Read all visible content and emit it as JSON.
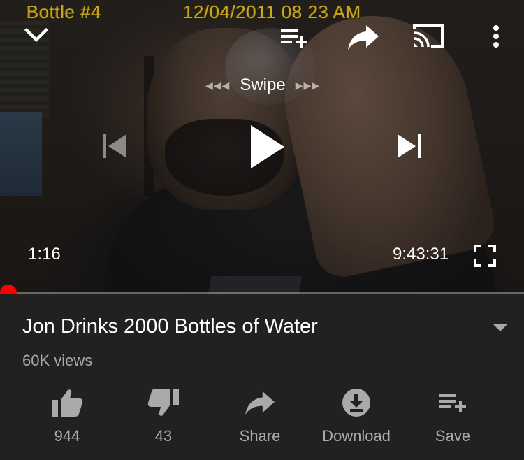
{
  "video_overlay": {
    "stamp_left": "Bottle #4",
    "stamp_right": "12/04/2011 08 23 AM"
  },
  "player": {
    "swipe_hint": "Swipe",
    "time_current": "1:16",
    "time_total": "9:43:31",
    "progress_fraction": 0.0022,
    "accent_color": "#ff0000",
    "icons": {
      "minimize": "chevron-down-icon",
      "add_to_queue": "playlist-add-icon",
      "share": "share-arrow-icon",
      "cast": "cast-icon",
      "more": "more-vert-icon",
      "previous": "skip-previous-icon",
      "play": "play-icon",
      "next": "skip-next-icon",
      "fullscreen": "fullscreen-icon"
    }
  },
  "video": {
    "title": "Jon Drinks 2000 Bottles of Water",
    "views": "60K views"
  },
  "actions": [
    {
      "id": "like",
      "label": "944",
      "icon": "thumb-up-icon"
    },
    {
      "id": "dislike",
      "label": "43",
      "icon": "thumb-down-icon"
    },
    {
      "id": "share",
      "label": "Share",
      "icon": "share-arrow-icon"
    },
    {
      "id": "download",
      "label": "Download",
      "icon": "download-icon"
    },
    {
      "id": "save",
      "label": "Save",
      "icon": "playlist-add-icon"
    }
  ]
}
